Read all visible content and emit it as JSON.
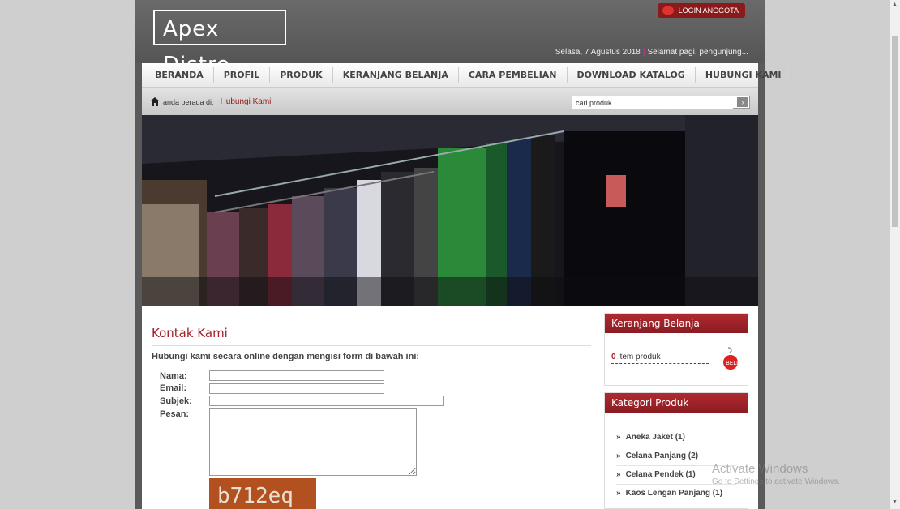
{
  "header": {
    "logo": "Apex Distro",
    "login_button": "LOGIN ANGGOTA",
    "date": "Selasa, 7 Agustus 2018",
    "separator": "|",
    "greeting": "Selamat pagi, pengunjung..."
  },
  "nav": {
    "items": [
      "BERANDA",
      "PROFIL",
      "PRODUK",
      "KERANJANG BELANJA",
      "CARA PEMBELIAN",
      "DOWNLOAD KATALOG",
      "HUBUNGI KAMI"
    ]
  },
  "breadcrumb": {
    "prefix": "anda berada di:",
    "current": "Hubungi Kami"
  },
  "search": {
    "placeholder": "cari produk",
    "button": "›"
  },
  "main": {
    "title": "Kontak Kami",
    "intro": "Hubungi kami secara online dengan mengisi form di bawah ini:",
    "labels": {
      "name": "Nama:",
      "email": "Email:",
      "subject": "Subjek:",
      "message": "Pesan:"
    },
    "captcha": "b712eq"
  },
  "sidebar": {
    "cart": {
      "title": "Keranjang Belanja",
      "count": "0",
      "unit": " item produk"
    },
    "categories": {
      "title": "Kategori Produk",
      "items": [
        "Aneka Jaket (1)",
        "Celana Panjang (2)",
        "Celana Pendek (1)",
        "Kaos Lengan Panjang (1)"
      ]
    }
  },
  "watermark": {
    "line1": "Activate Windows",
    "line2": "Go to Settings to activate Windows."
  }
}
